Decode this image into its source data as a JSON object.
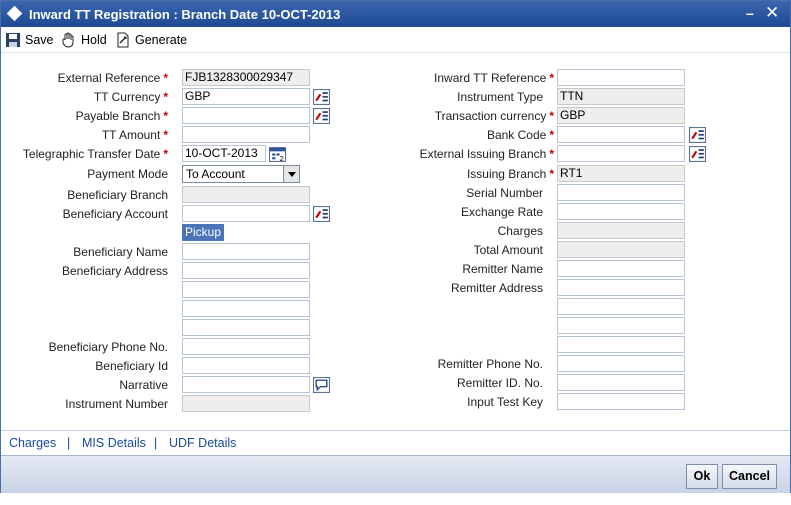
{
  "window": {
    "title": "Inward TT Registration : Branch Date 10-OCT-2013"
  },
  "toolbar": {
    "save_label": "Save",
    "hold_label": "Hold",
    "generate_label": "Generate"
  },
  "left": {
    "external_reference": {
      "label": "External Reference",
      "value": "FJB1328300029347"
    },
    "tt_currency": {
      "label": "TT Currency",
      "value": "GBP"
    },
    "payable_branch": {
      "label": "Payable Branch",
      "value": ""
    },
    "tt_amount": {
      "label": "TT Amount",
      "value": ""
    },
    "telegraphic_transfer_date": {
      "label": "Telegraphic Transfer Date",
      "value": "10-OCT-2013"
    },
    "payment_mode": {
      "label": "Payment Mode",
      "value": "To Account"
    },
    "beneficiary_branch": {
      "label": "Beneficiary Branch",
      "value": ""
    },
    "beneficiary_account": {
      "label": "Beneficiary Account",
      "value": ""
    },
    "pickup_label": "Pickup",
    "beneficiary_name": {
      "label": "Beneficiary Name",
      "value": ""
    },
    "beneficiary_address": {
      "label": "Beneficiary Address",
      "lines": [
        "",
        "",
        "",
        ""
      ]
    },
    "beneficiary_phone": {
      "label": "Beneficiary Phone No.",
      "value": ""
    },
    "beneficiary_id": {
      "label": "Beneficiary Id",
      "value": ""
    },
    "narrative": {
      "label": "Narrative",
      "value": ""
    },
    "instrument_number": {
      "label": "Instrument Number",
      "value": ""
    }
  },
  "right": {
    "inward_tt_reference": {
      "label": "Inward TT Reference",
      "value": ""
    },
    "instrument_type": {
      "label": "Instrument Type",
      "value": "TTN"
    },
    "transaction_currency": {
      "label": "Transaction currency",
      "value": "GBP"
    },
    "bank_code": {
      "label": "Bank Code",
      "value": ""
    },
    "external_issuing_branch": {
      "label": "External Issuing Branch",
      "value": ""
    },
    "issuing_branch": {
      "label": "Issuing Branch",
      "value": "RT1"
    },
    "serial_number": {
      "label": "Serial Number",
      "value": ""
    },
    "exchange_rate": {
      "label": "Exchange Rate",
      "value": ""
    },
    "charges": {
      "label": "Charges",
      "value": ""
    },
    "total_amount": {
      "label": "Total Amount",
      "value": ""
    },
    "remitter_name": {
      "label": "Remitter Name",
      "value": ""
    },
    "remitter_address": {
      "label": "Remitter Address",
      "lines": [
        "",
        "",
        "",
        ""
      ]
    },
    "remitter_phone": {
      "label": "Remitter Phone No.",
      "value": ""
    },
    "remitter_id": {
      "label": "Remitter ID. No.",
      "value": ""
    },
    "input_test_key": {
      "label": "Input Test Key",
      "value": ""
    }
  },
  "footer": {
    "charges_link": "Charges",
    "mis_link": "MIS Details",
    "udf_link": "UDF Details",
    "separator": "|"
  },
  "buttons": {
    "ok_label": "Ok",
    "cancel_label": "Cancel"
  },
  "required_marker": "*",
  "icons": {
    "lov": "list-lookup-icon",
    "calendar": "calendar-icon",
    "narrative": "speech-bubble-icon",
    "save": "floppy-disk-icon",
    "hold": "hand-icon",
    "generate": "generate-document-icon"
  },
  "colors": {
    "titlebar": "#2a5aa5",
    "required": "#c00000",
    "link": "#1a4a9c",
    "pickup": "#4a74b7"
  }
}
